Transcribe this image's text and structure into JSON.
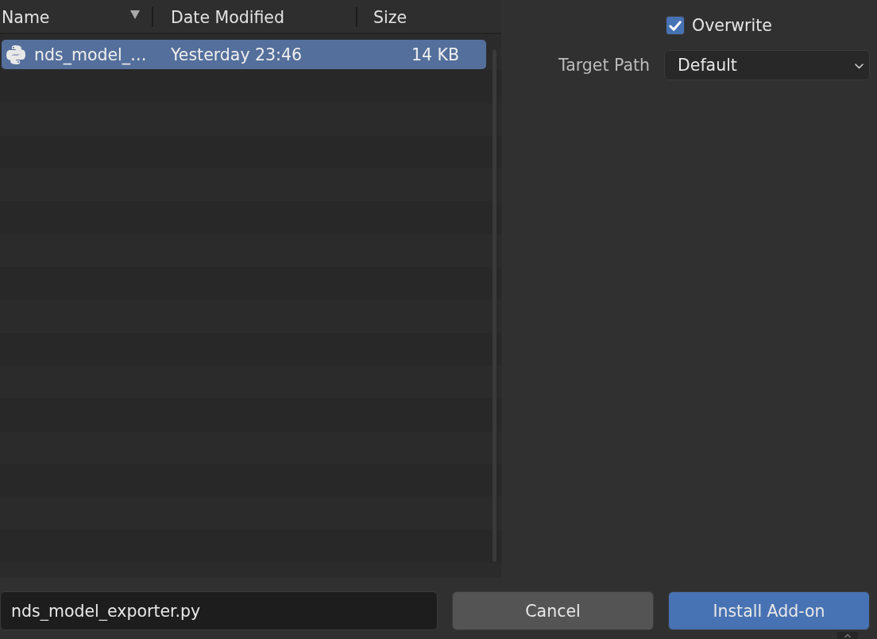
{
  "file_list": {
    "columns": [
      {
        "label": "Name",
        "sorted": true
      },
      {
        "label": "Date Modified",
        "sorted": false
      },
      {
        "label": "Size",
        "sorted": false
      }
    ],
    "rows": [
      {
        "kind": "python",
        "name": "nds_model_…",
        "date_modified": "Yesterday 23:46",
        "size": "14 KB",
        "selected": true
      }
    ]
  },
  "options": {
    "overwrite": {
      "label": "Overwrite",
      "checked": true
    },
    "target_path": {
      "label": "Target Path",
      "value": "Default"
    }
  },
  "filename": {
    "value": "nds_model_exporter.py"
  },
  "buttons": [
    {
      "label": "Cancel",
      "kind": "secondary"
    },
    {
      "label": "Install Add-on",
      "kind": "primary"
    }
  ]
}
